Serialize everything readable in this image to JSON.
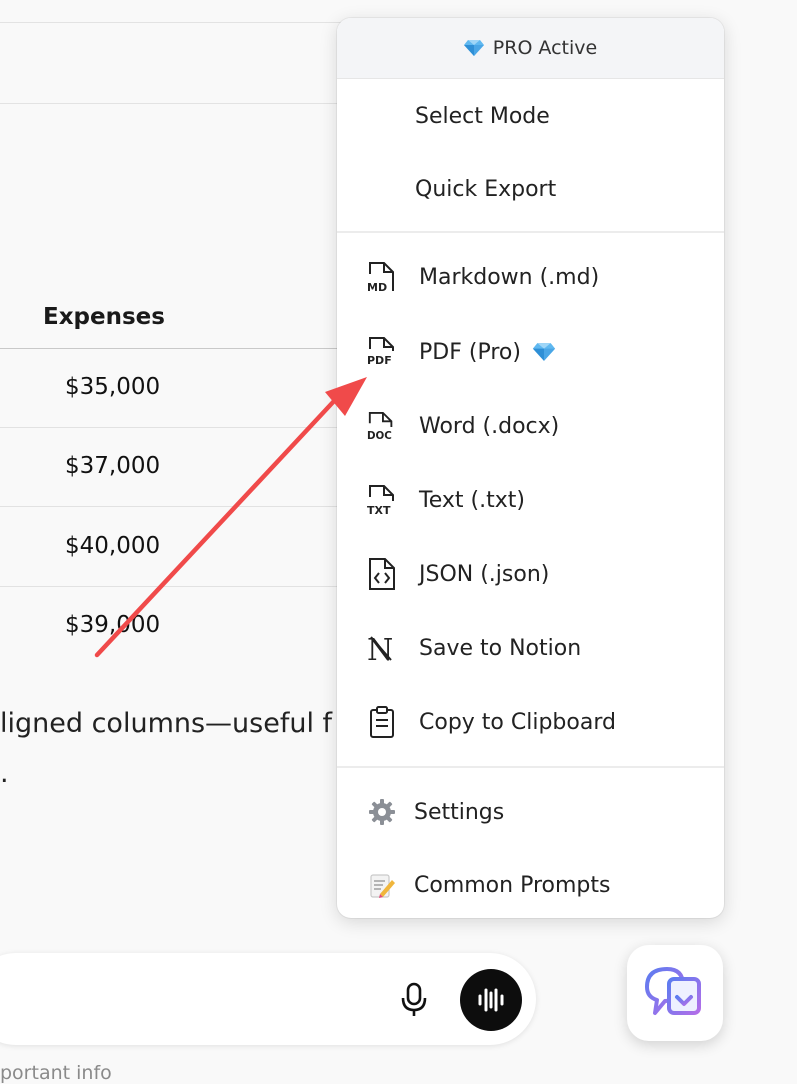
{
  "table": {
    "header": "Expenses",
    "rows": [
      "$35,000",
      "$37,000",
      "$40,000",
      "$39,000"
    ]
  },
  "paragraph": {
    "line1": "ligned columns—useful f",
    "line2": "."
  },
  "input": {
    "placeholder": ""
  },
  "footer_note": "portant info",
  "menu": {
    "badge": "PRO Active",
    "select_mode": "Select Mode",
    "quick_export": "Quick Export",
    "export_items": [
      {
        "label": "Markdown (.md)",
        "icon": "md-file-icon"
      },
      {
        "label": "PDF (Pro)",
        "icon": "pdf-file-icon"
      },
      {
        "label": "Word (.docx)",
        "icon": "doc-file-icon"
      },
      {
        "label": "Text (.txt)",
        "icon": "txt-file-icon"
      },
      {
        "label": "JSON (.json)",
        "icon": "json-file-icon"
      },
      {
        "label": "Save to Notion",
        "icon": "notion-icon"
      },
      {
        "label": "Copy to Clipboard",
        "icon": "clipboard-icon"
      }
    ],
    "settings": "Settings",
    "common_prompts": "Common Prompts"
  },
  "colors": {
    "accent_arrow": "#f04a4a",
    "diamond": "#3aa0e8"
  }
}
